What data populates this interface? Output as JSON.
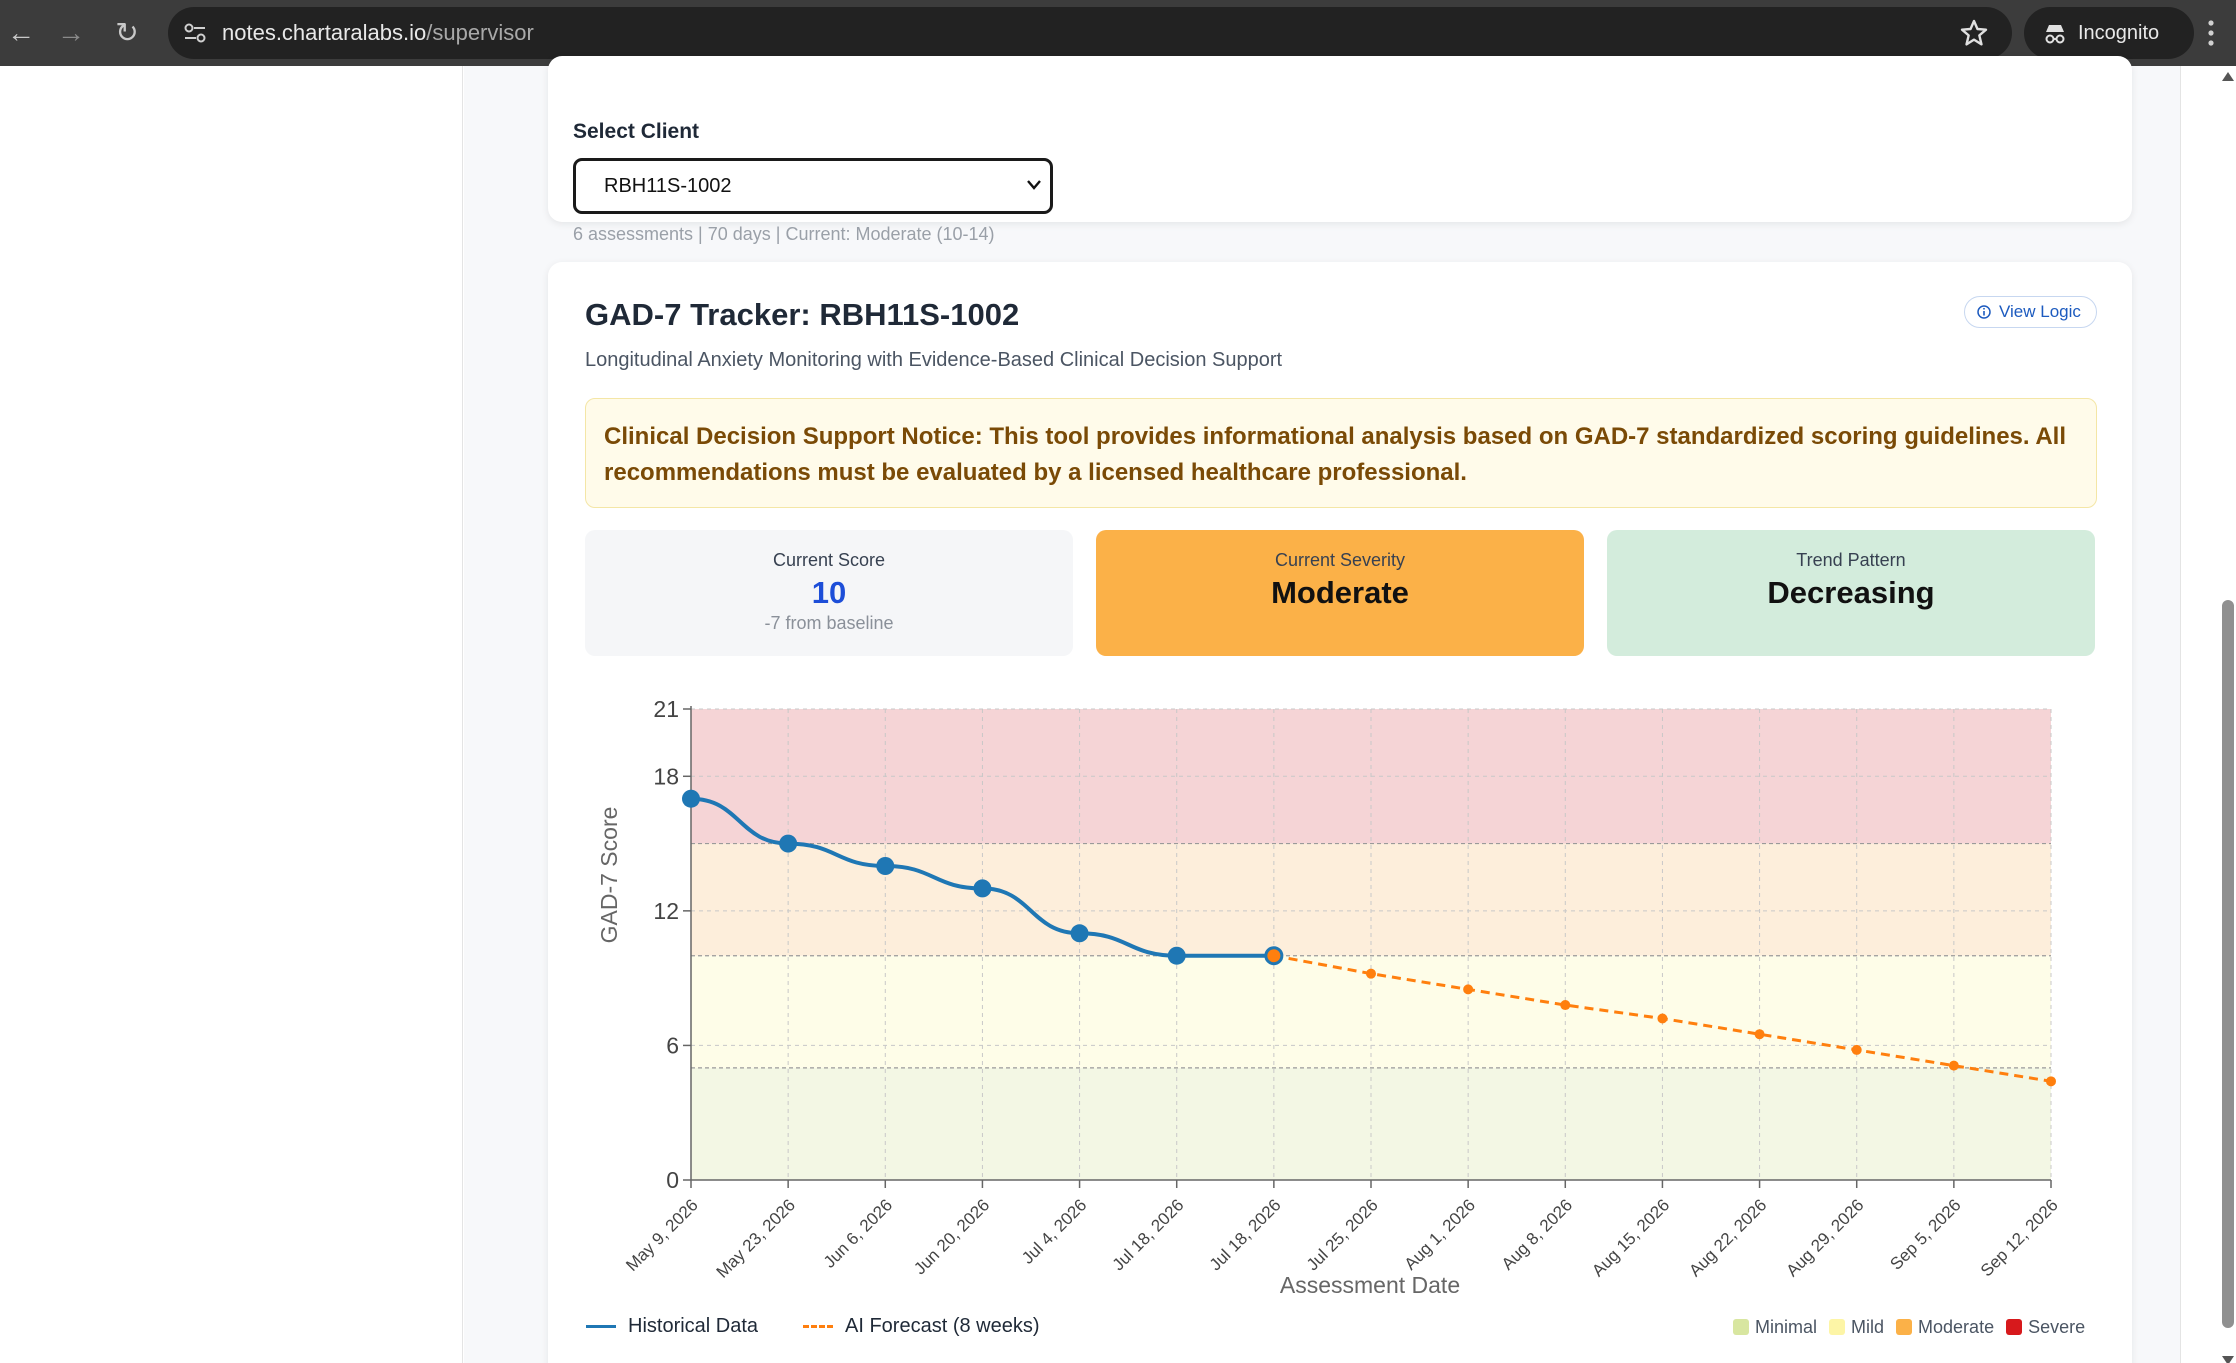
{
  "browser": {
    "url_host": "notes.chartaralabs.io",
    "url_path": "/supervisor",
    "incognito_label": "Incognito"
  },
  "client_select": {
    "label": "Select Client",
    "value": "RBH11S-1002",
    "meta": "6 assessments | 70 days | Current: Moderate (10-14)"
  },
  "tracker": {
    "title": "GAD-7 Tracker: RBH11S-1002",
    "subtitle": "Longitudinal Anxiety Monitoring with Evidence-Based Clinical Decision Support",
    "view_logic": "View Logic",
    "notice": "Clinical Decision Support Notice: This tool provides informational analysis based on GAD-7 standardized scoring guidelines. All recommendations must be evaluated by a licensed healthcare professional."
  },
  "stats": {
    "current_score_label": "Current Score",
    "current_score": "10",
    "current_score_sub": "-7 from baseline",
    "severity_label": "Current Severity",
    "severity": "Moderate",
    "trend_label": "Trend Pattern",
    "trend": "Decreasing"
  },
  "colors": {
    "historical": "#1f77b4",
    "forecast": "#ff7f0e",
    "band_minimal": "#f3f7e4",
    "band_mild": "#fefde8",
    "band_moderate": "#fdeedb",
    "band_severe": "#f5d4d6"
  },
  "legend": {
    "historical": "Historical Data",
    "forecast": "AI Forecast (8 weeks)",
    "bands": [
      {
        "label": "Minimal",
        "color": "#d8e6a0"
      },
      {
        "label": "Mild",
        "color": "#fdf5a6"
      },
      {
        "label": "Moderate",
        "color": "#fbb148"
      },
      {
        "label": "Severe",
        "color": "#d7191c"
      }
    ]
  },
  "chart_data": {
    "type": "line",
    "xlabel": "Assessment Date",
    "ylabel": "GAD-7 Score",
    "ylim": [
      0,
      21
    ],
    "yticks": [
      0,
      6,
      12,
      18,
      21
    ],
    "x": [
      "May 9, 2026",
      "May 23, 2026",
      "Jun 6, 2026",
      "Jun 20, 2026",
      "Jul 4, 2026",
      "Jul 18, 2026",
      "Jul 18, 2026",
      "Jul 25, 2026",
      "Aug 1, 2026",
      "Aug 8, 2026",
      "Aug 15, 2026",
      "Aug 22, 2026",
      "Aug 29, 2026",
      "Sep 5, 2026",
      "Sep 12, 2026"
    ],
    "bands": [
      {
        "name": "Minimal",
        "from": 0,
        "to": 5
      },
      {
        "name": "Mild",
        "from": 5,
        "to": 10
      },
      {
        "name": "Moderate",
        "from": 10,
        "to": 15
      },
      {
        "name": "Severe",
        "from": 15,
        "to": 21
      }
    ],
    "series": [
      {
        "name": "Historical Data",
        "x_index": [
          0,
          1,
          2,
          3,
          4,
          5,
          6
        ],
        "values": [
          17,
          15,
          14,
          13,
          11,
          10,
          10
        ]
      },
      {
        "name": "AI Forecast (8 weeks)",
        "x_index": [
          6,
          7,
          8,
          9,
          10,
          11,
          12,
          13,
          14
        ],
        "values": [
          10,
          9.2,
          8.5,
          7.8,
          7.2,
          6.5,
          5.8,
          5.1,
          4.4
        ]
      }
    ],
    "grid": true
  }
}
